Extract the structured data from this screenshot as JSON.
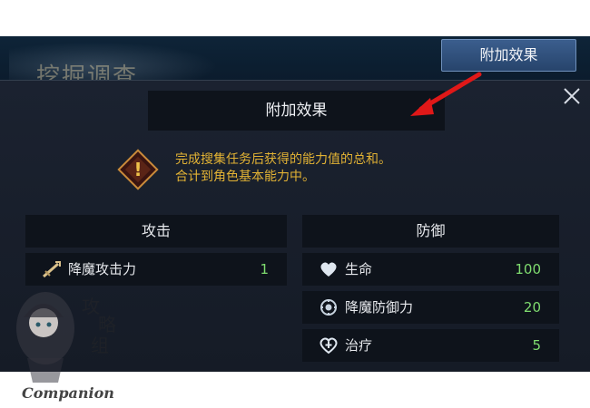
{
  "backdrop": {
    "title": "挖掘调查"
  },
  "top_tab": {
    "label": "附加效果"
  },
  "dialog": {
    "title": "附加效果",
    "description_line1": "完成搜集任务后获得的能力值的总和。",
    "description_line2": "合计到角色基本能力中。"
  },
  "attack": {
    "header": "攻击",
    "rows": [
      {
        "label": "降魔攻击力",
        "value": "1",
        "icon": "sword-icon"
      }
    ]
  },
  "defense": {
    "header": "防御",
    "rows": [
      {
        "label": "生命",
        "value": "100",
        "icon": "heart-icon"
      },
      {
        "label": "降魔防御力",
        "value": "20",
        "icon": "shield-icon"
      },
      {
        "label": "治疗",
        "value": "5",
        "icon": "heal-icon"
      }
    ]
  },
  "watermark": {
    "text": "Companion",
    "brand": "攻略组"
  },
  "colors": {
    "accent_gold": "#e2b234",
    "value_green": "#7fdc6f",
    "annotation_red": "#e01818"
  }
}
